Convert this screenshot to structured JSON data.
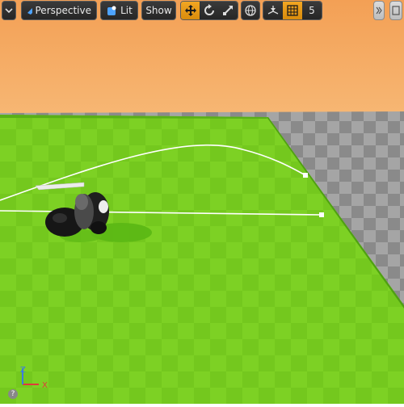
{
  "toolbar": {
    "view_mode_label": "Perspective",
    "lighting_label": "Lit",
    "show_label": "Show",
    "snap_value": "5",
    "menu_icon": "chevron-down-icon",
    "transform_tools": [
      "move-icon",
      "rotate-icon",
      "scale-icon"
    ],
    "world_icon": "globe-icon",
    "surface_snap_icon": "surface-snap-icon",
    "grid_icon": "grid-snap-icon",
    "overflow_icon": "chevron-double-right-icon"
  },
  "axis_gizmo": {
    "x_label": "X",
    "z_label": "Z"
  },
  "help_label": "?",
  "colors": {
    "sky_top": "#f4a257",
    "sky_bottom": "#f6b46f",
    "floor_green": "#7ed321",
    "floor_green_dark": "#56a818",
    "checker_gray": "#9a9a9a",
    "accent_orange": "#e8970f",
    "axis_x": "#e03a3a",
    "axis_z": "#3b7be0"
  }
}
